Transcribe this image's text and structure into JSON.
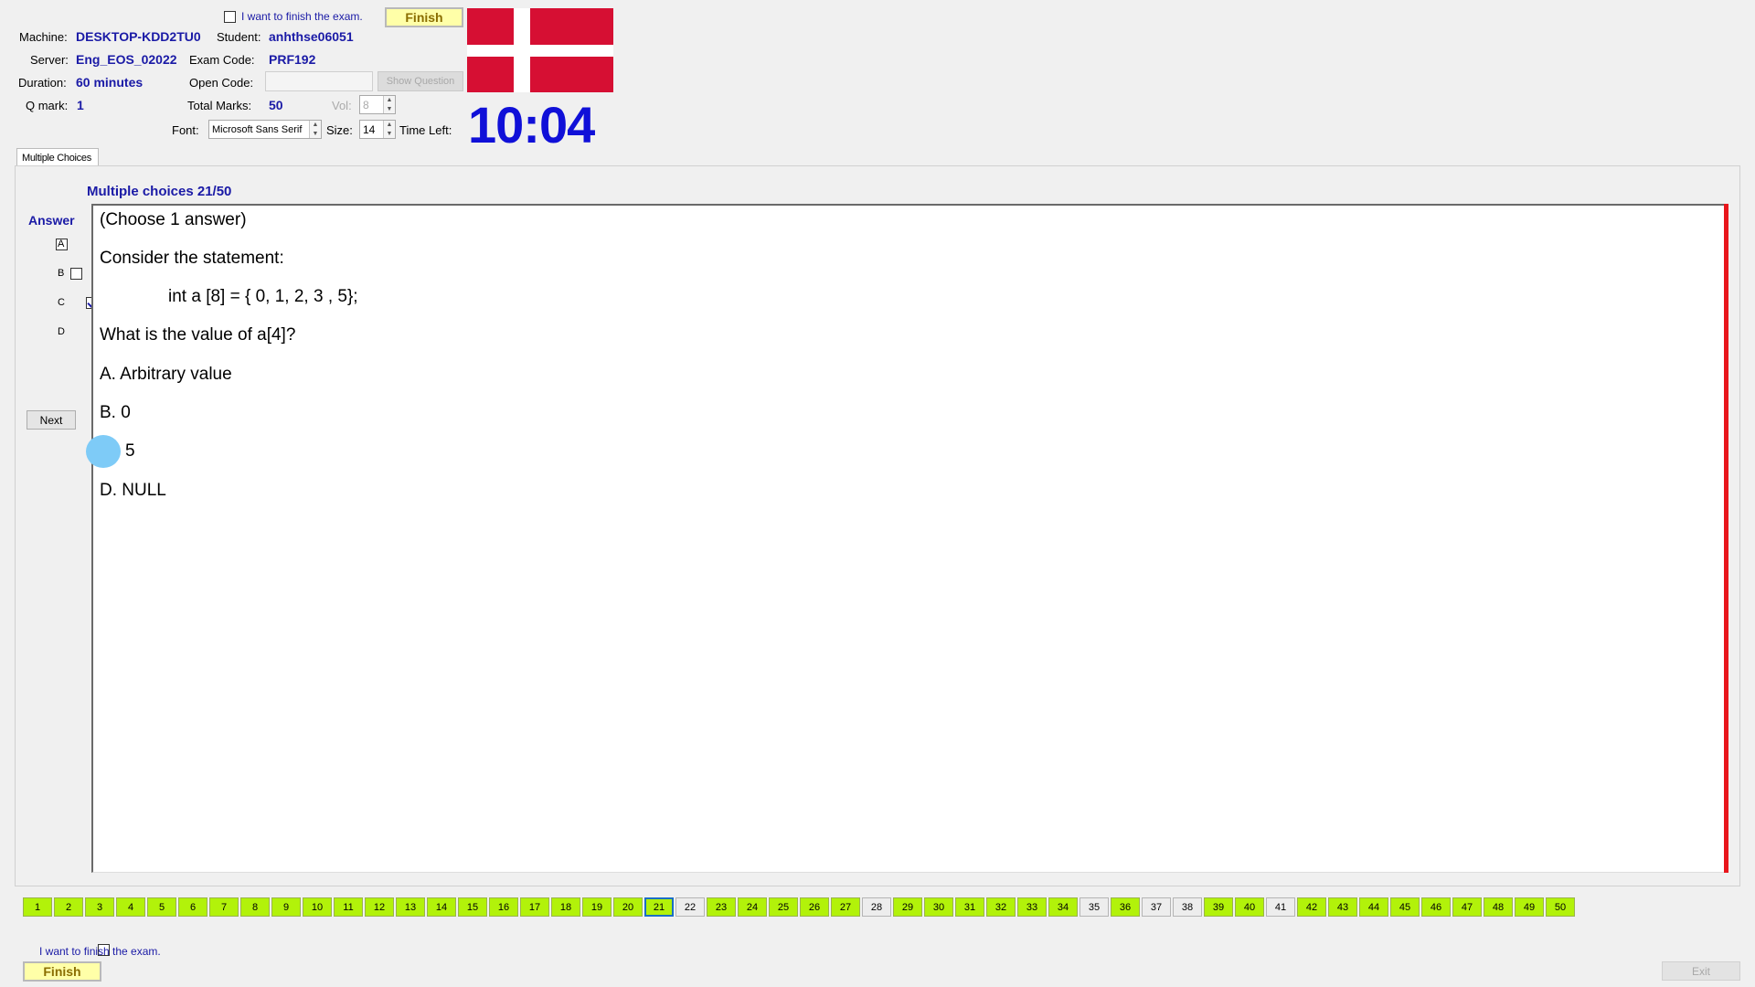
{
  "header": {
    "finish_check_label": "I want to finish the exam.",
    "finish_button": "Finish",
    "machine_label": "Machine:",
    "machine_value": "DESKTOP-KDD2TU0",
    "student_label": "Student:",
    "student_value": "anhthse06051",
    "server_label": "Server:",
    "server_value": "Eng_EOS_02022",
    "exam_code_label": "Exam Code:",
    "exam_code_value": "PRF192",
    "duration_label": "Duration:",
    "duration_value": "60 minutes",
    "open_code_label": "Open Code:",
    "open_code_value": "",
    "show_question_button": "Show Question",
    "qmark_label": "Q mark:",
    "qmark_value": "1",
    "total_marks_label": "Total Marks:",
    "total_marks_value": "50",
    "vol_label": "Vol:",
    "vol_value": "8",
    "font_label": "Font:",
    "font_value": "Microsoft Sans Serif",
    "size_label": "Size:",
    "size_value": "14",
    "time_left_label": "Time Left:",
    "time_left_value": "10:04",
    "flag_colors": {
      "red": "#d60f33",
      "white": "#ffffff"
    }
  },
  "tab": {
    "label": "Multiple Choices"
  },
  "question": {
    "heading": "Multiple choices 21/50",
    "lines": [
      "(Choose 1 answer)",
      "Consider the statement:",
      "int a [8] = { 0, 1, 2, 3 , 5};",
      "What is the value of a[4]?",
      "A.  Arbitrary value",
      "B.  0",
      "5",
      "D.  NULL"
    ]
  },
  "answer": {
    "title": "Answer",
    "options": [
      {
        "label": "A",
        "checked": false
      },
      {
        "label": "B",
        "checked": false
      },
      {
        "label": "C",
        "checked": true
      },
      {
        "label": "D",
        "checked": false
      }
    ],
    "next_button": "Next"
  },
  "navigation": {
    "current": 21,
    "numbers": [
      {
        "n": "1",
        "state": "done"
      },
      {
        "n": "2",
        "state": "done"
      },
      {
        "n": "3",
        "state": "done"
      },
      {
        "n": "4",
        "state": "done"
      },
      {
        "n": "5",
        "state": "done"
      },
      {
        "n": "6",
        "state": "done"
      },
      {
        "n": "7",
        "state": "done"
      },
      {
        "n": "8",
        "state": "done"
      },
      {
        "n": "9",
        "state": "done"
      },
      {
        "n": "10",
        "state": "done"
      },
      {
        "n": "11",
        "state": "done"
      },
      {
        "n": "12",
        "state": "done"
      },
      {
        "n": "13",
        "state": "done"
      },
      {
        "n": "14",
        "state": "done"
      },
      {
        "n": "15",
        "state": "done"
      },
      {
        "n": "16",
        "state": "done"
      },
      {
        "n": "17",
        "state": "done"
      },
      {
        "n": "18",
        "state": "done"
      },
      {
        "n": "19",
        "state": "done"
      },
      {
        "n": "20",
        "state": "done"
      },
      {
        "n": "21",
        "state": "current"
      },
      {
        "n": "22",
        "state": "todo"
      },
      {
        "n": "23",
        "state": "done"
      },
      {
        "n": "24",
        "state": "done"
      },
      {
        "n": "25",
        "state": "done"
      },
      {
        "n": "26",
        "state": "done"
      },
      {
        "n": "27",
        "state": "done"
      },
      {
        "n": "28",
        "state": "todo"
      },
      {
        "n": "29",
        "state": "done"
      },
      {
        "n": "30",
        "state": "done"
      },
      {
        "n": "31",
        "state": "done"
      },
      {
        "n": "32",
        "state": "done"
      },
      {
        "n": "33",
        "state": "done"
      },
      {
        "n": "34",
        "state": "done"
      },
      {
        "n": "35",
        "state": "todo"
      },
      {
        "n": "36",
        "state": "done"
      },
      {
        "n": "37",
        "state": "todo"
      },
      {
        "n": "38",
        "state": "todo"
      },
      {
        "n": "39",
        "state": "done"
      },
      {
        "n": "40",
        "state": "done"
      },
      {
        "n": "41",
        "state": "todo"
      },
      {
        "n": "42",
        "state": "done"
      },
      {
        "n": "43",
        "state": "done"
      },
      {
        "n": "44",
        "state": "done"
      },
      {
        "n": "45",
        "state": "done"
      },
      {
        "n": "46",
        "state": "done"
      },
      {
        "n": "47",
        "state": "done"
      },
      {
        "n": "48",
        "state": "done"
      },
      {
        "n": "49",
        "state": "done"
      },
      {
        "n": "50",
        "state": "done"
      }
    ]
  },
  "footer": {
    "finish_check_label": "I want to finish the exam.",
    "finish_button": "Finish",
    "exit_button": "Exit"
  }
}
